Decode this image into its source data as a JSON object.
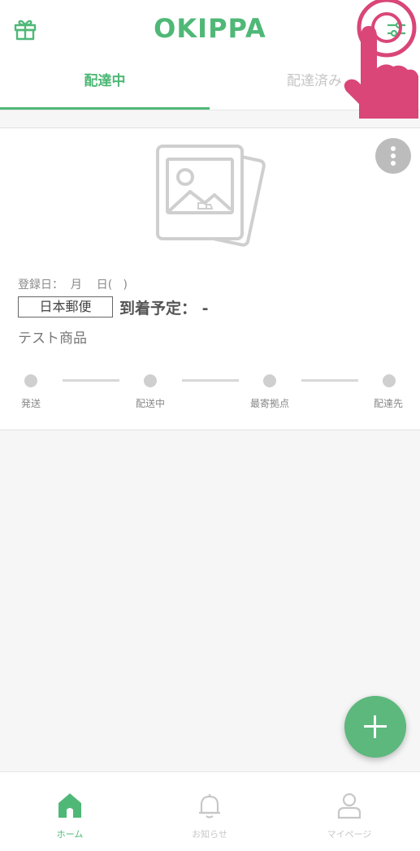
{
  "header": {
    "logo": "OKIPPA",
    "gift_icon": "gift-icon",
    "filter_icon": "filter-sliders-icon"
  },
  "tabs": [
    {
      "label": "配達中",
      "active": true
    },
    {
      "label": "配達済み",
      "active": false
    }
  ],
  "card": {
    "registered_label": "登録日：  月    日(   )",
    "carrier": "日本郵便",
    "eta_label": "到着予定： -",
    "product_name": "テスト商品",
    "steps": [
      "発送",
      "配送中",
      "最寄拠点",
      "配達先"
    ]
  },
  "fab": {
    "icon": "plus-icon"
  },
  "bottom_nav": [
    {
      "label": "ホーム",
      "icon": "home-icon",
      "active": true
    },
    {
      "label": "お知らせ",
      "icon": "bell-icon",
      "active": false
    },
    {
      "label": "マイページ",
      "icon": "user-icon",
      "active": false
    }
  ],
  "colors": {
    "brand_green": "#4fb877",
    "pointer_pink": "#d94677"
  }
}
